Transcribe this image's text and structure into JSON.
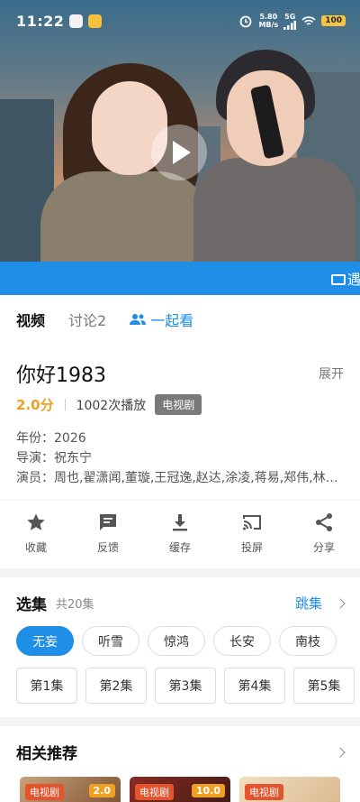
{
  "status_bar": {
    "time": "11:22",
    "net_speed": "5.80",
    "net_unit": "MB/s",
    "signal_label": "5G",
    "battery": "100"
  },
  "banner": {
    "text": "遇"
  },
  "tabs": [
    {
      "label": "视频"
    },
    {
      "label": "讨论2"
    },
    {
      "label": "一起看"
    }
  ],
  "show": {
    "title": "你好1983",
    "expand_label": "展开",
    "score": "2.0分",
    "plays": "1002次播放",
    "genre": "电视剧",
    "year": "年份：2026",
    "director": "导演：祝东宁",
    "cast": "演员：周也,翟潇闻,董璇,王冠逸,赵达,涂凌,蒋易,郑伟,林…"
  },
  "actions": [
    {
      "label": "收藏",
      "icon": "star-icon"
    },
    {
      "label": "反馈",
      "icon": "feedback-icon"
    },
    {
      "label": "缓存",
      "icon": "download-icon"
    },
    {
      "label": "投屏",
      "icon": "cast-icon"
    },
    {
      "label": "分享",
      "icon": "share-icon"
    }
  ],
  "episodes": {
    "title": "选集",
    "count": "共20集",
    "jump_label": "跳集",
    "arcs": [
      "无妄",
      "听雪",
      "惊鸿",
      "长安",
      "南枝"
    ],
    "items": [
      "第1集",
      "第2集",
      "第3集",
      "第4集",
      "第5集"
    ]
  },
  "related": {
    "title": "相关推荐",
    "items": [
      {
        "tag": "电视剧",
        "score": "2.0"
      },
      {
        "tag": "电视剧",
        "score": "10.0"
      },
      {
        "tag": "电视剧",
        "score": ""
      }
    ]
  },
  "colors": {
    "accent": "#1e8ee6",
    "score": "#f0a020",
    "tag": "#e5532c"
  }
}
